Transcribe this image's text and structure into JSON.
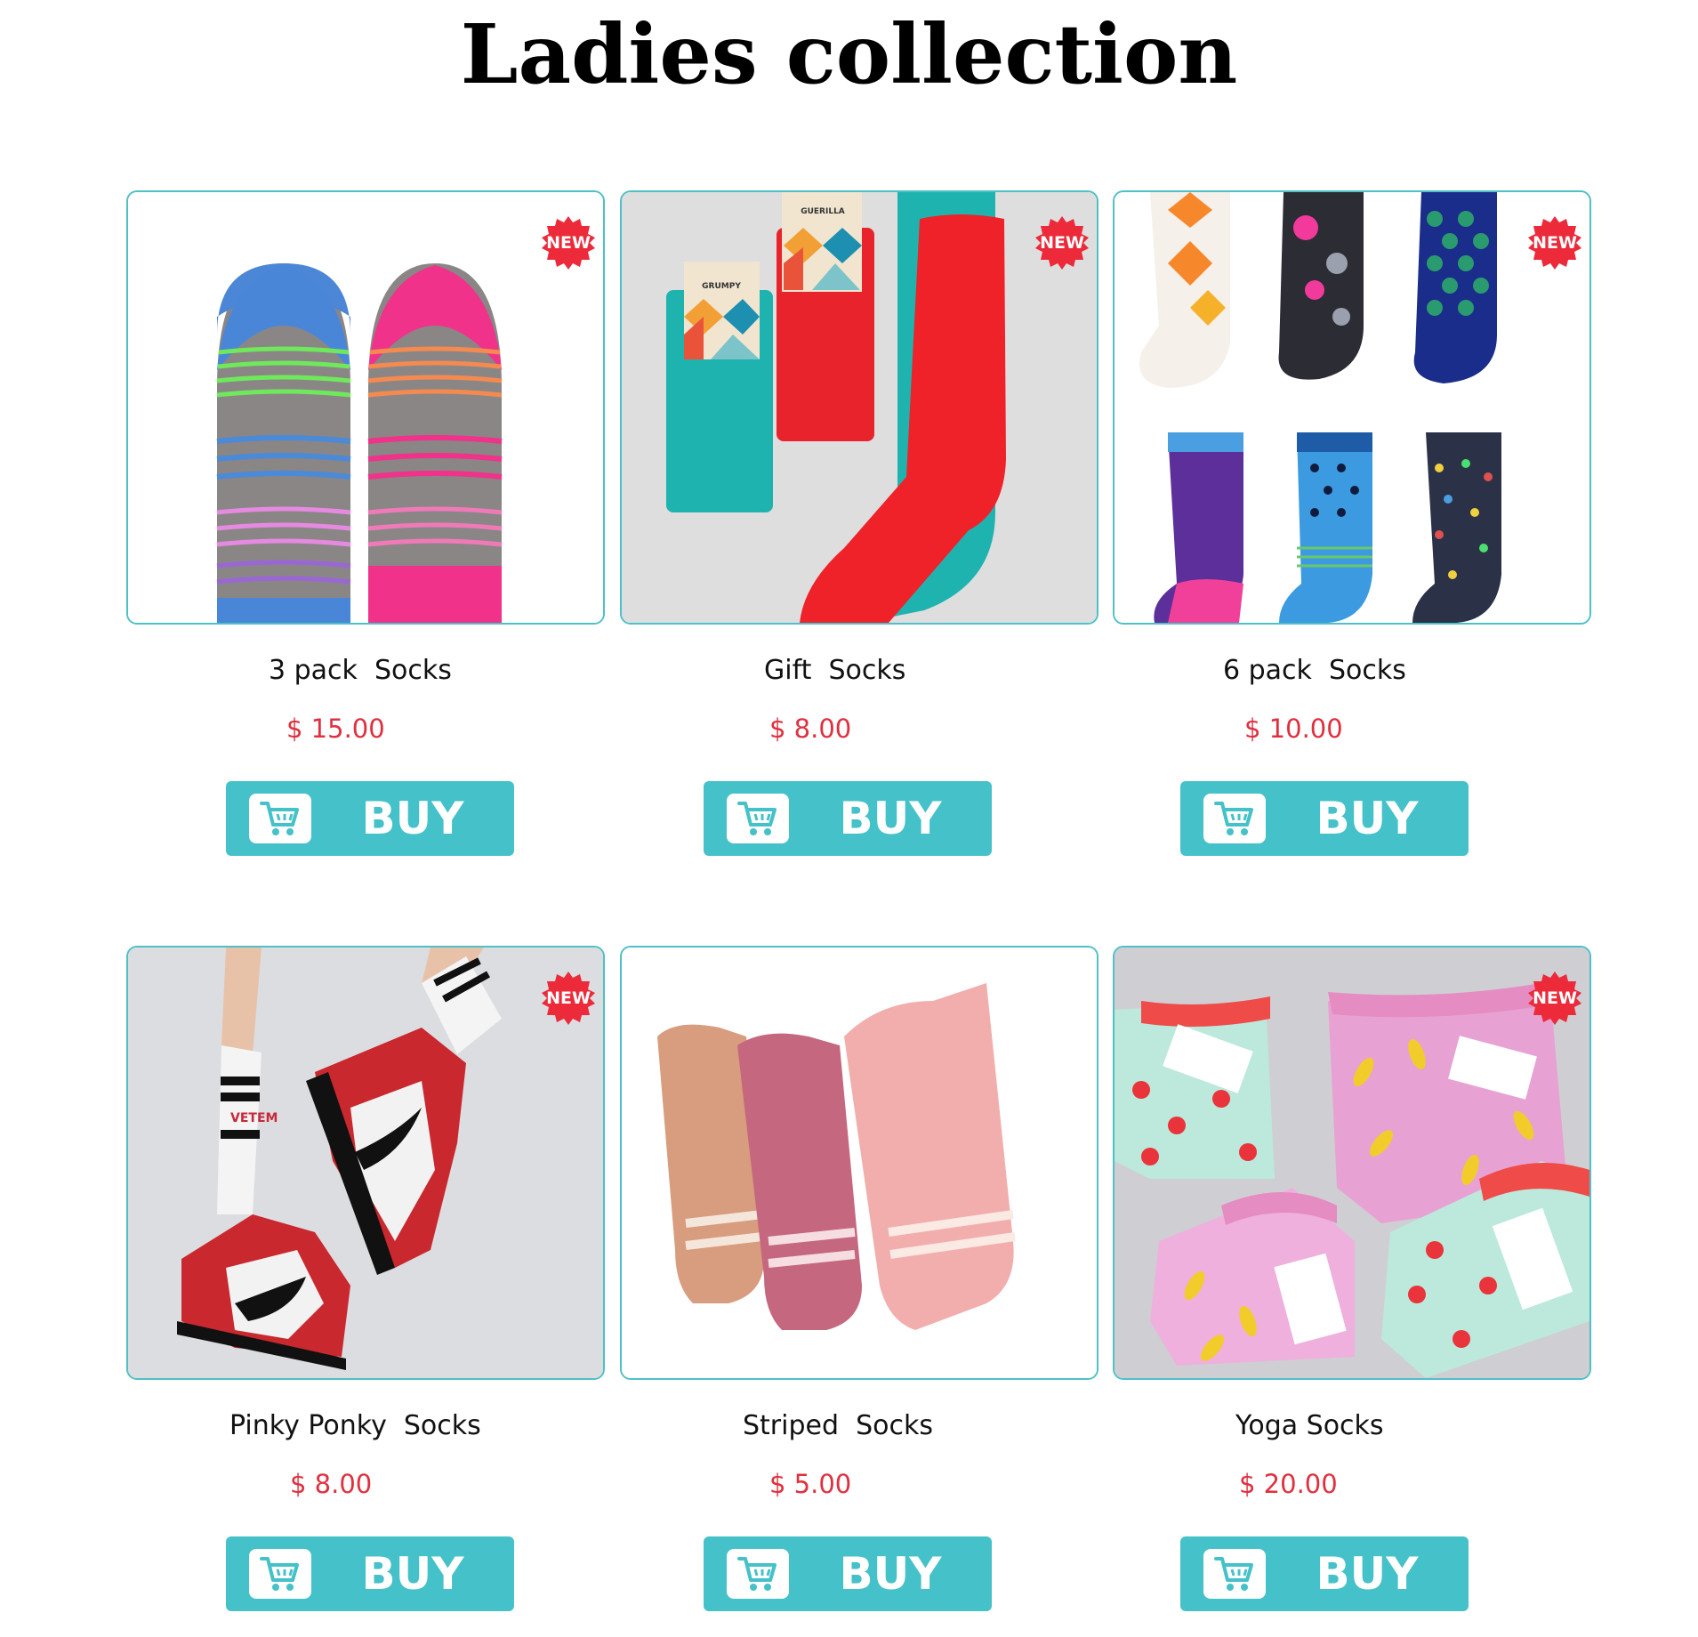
{
  "page": {
    "title": "Ladies collection"
  },
  "badge_label": "NEW",
  "buy_label": "BUY",
  "colors": {
    "accent": "#45c1c9",
    "price": "#e0303f",
    "badge": "#ec2a3a"
  },
  "products": [
    {
      "name": "3 pack  Socks",
      "price": "$ 15.00",
      "is_new": true
    },
    {
      "name": "Gift  Socks",
      "price": "$ 8.00",
      "is_new": true
    },
    {
      "name": "6 pack  Socks",
      "price": "$ 10.00",
      "is_new": true
    },
    {
      "name": "Pinky Ponky  Socks",
      "price": "$ 8.00",
      "is_new": true
    },
    {
      "name": "Striped  Socks",
      "price": "$ 5.00",
      "is_new": false
    },
    {
      "name": "Yoga Socks",
      "price": "$ 20.00",
      "is_new": true
    }
  ],
  "brand_tag": "GRUMPY GUERILLA",
  "sock_text": "VETEM"
}
